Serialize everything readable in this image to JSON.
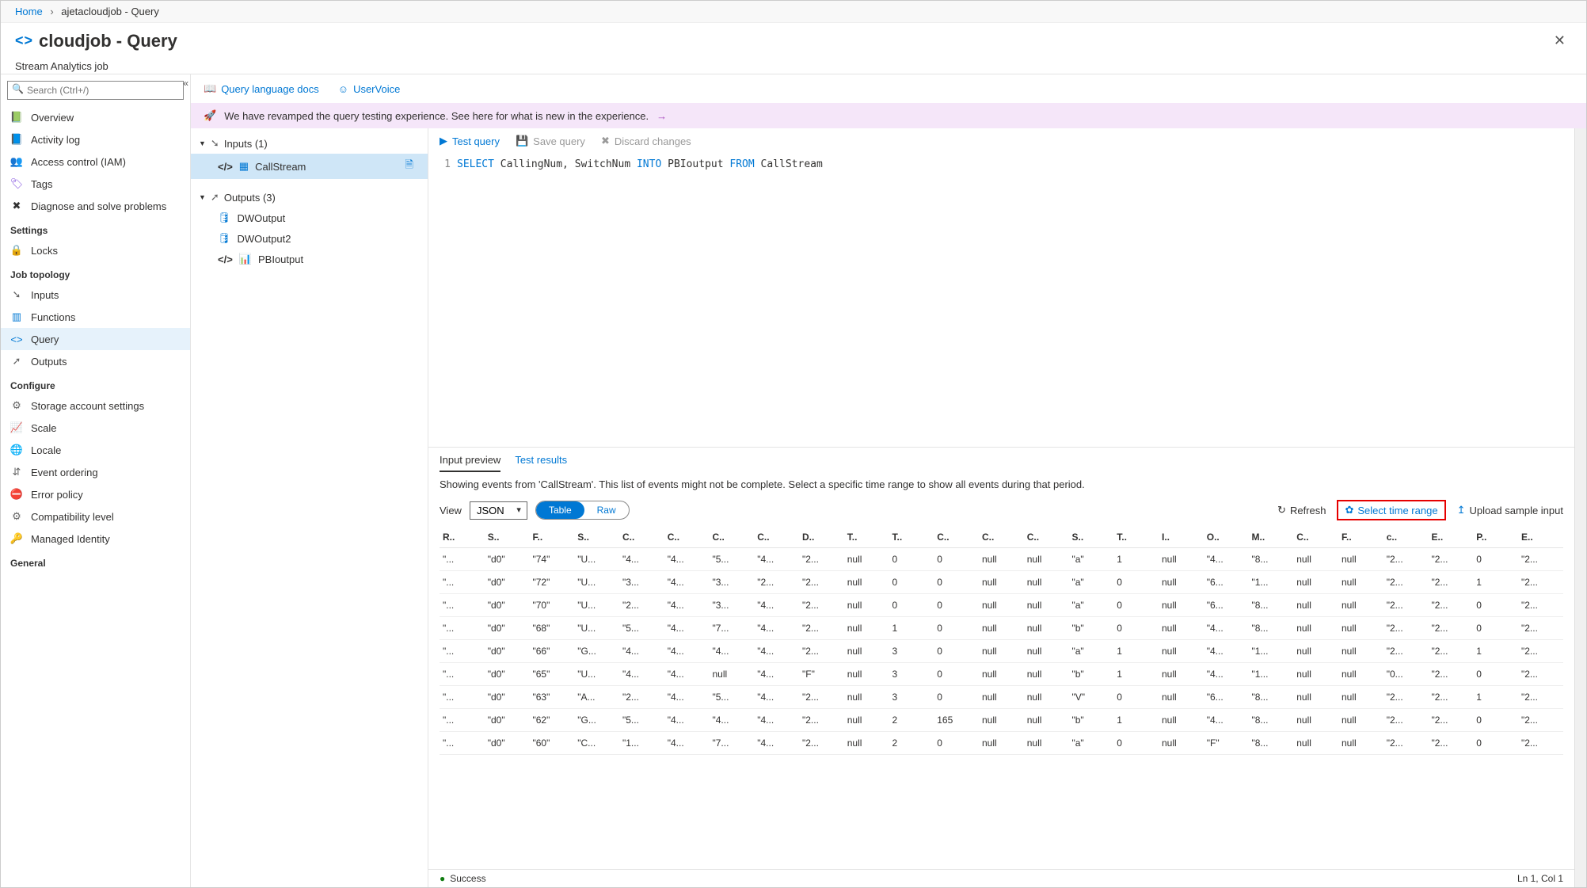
{
  "breadcrumb": {
    "home": "Home",
    "page": "ajetacloudjob - Query"
  },
  "header": {
    "title": "cloudjob - Query",
    "subtitle": "Stream Analytics job"
  },
  "search": {
    "placeholder": "Search (Ctrl+/)"
  },
  "nav": {
    "group1": [
      {
        "id": "overview",
        "label": "Overview",
        "icon": "📗",
        "color": "#2e8540"
      },
      {
        "id": "activity",
        "label": "Activity log",
        "icon": "📘",
        "color": "#0078d4"
      },
      {
        "id": "access",
        "label": "Access control (IAM)",
        "icon": "👥",
        "color": "#0078d4"
      },
      {
        "id": "tags",
        "label": "Tags",
        "icon": "🏷",
        "color": "#8250df"
      },
      {
        "id": "diagnose",
        "label": "Diagnose and solve problems",
        "icon": "✖",
        "color": "#333"
      }
    ],
    "settings_label": "Settings",
    "settings": [
      {
        "id": "locks",
        "label": "Locks",
        "icon": "🔒",
        "color": "#333"
      }
    ],
    "topology_label": "Job topology",
    "topology": [
      {
        "id": "inputs",
        "label": "Inputs",
        "icon": "➘",
        "color": "#666"
      },
      {
        "id": "functions",
        "label": "Functions",
        "icon": "▥",
        "color": "#0078d4"
      },
      {
        "id": "query",
        "label": "Query",
        "icon": "<>",
        "color": "#0078d4",
        "selected": true
      },
      {
        "id": "outputs",
        "label": "Outputs",
        "icon": "➚",
        "color": "#666"
      }
    ],
    "configure_label": "Configure",
    "configure": [
      {
        "id": "storage",
        "label": "Storage account settings",
        "icon": "⚙",
        "color": "#666"
      },
      {
        "id": "scale",
        "label": "Scale",
        "icon": "📈",
        "color": "#0078d4"
      },
      {
        "id": "locale",
        "label": "Locale",
        "icon": "🌐",
        "color": "#2e8540"
      },
      {
        "id": "ordering",
        "label": "Event ordering",
        "icon": "⇵",
        "color": "#666"
      },
      {
        "id": "error",
        "label": "Error policy",
        "icon": "⛔",
        "color": "#d13438"
      },
      {
        "id": "compat",
        "label": "Compatibility level",
        "icon": "⚙",
        "color": "#666"
      },
      {
        "id": "identity",
        "label": "Managed Identity",
        "icon": "🔑",
        "color": "#f2c811"
      }
    ],
    "general_label": "General"
  },
  "toolbar": {
    "docs": "Query language docs",
    "uservoice": "UserVoice"
  },
  "banner": "We have revamped the query testing experience. See here for what is new in the experience.",
  "tree": {
    "inputs_label": "Inputs (1)",
    "inputs": [
      {
        "id": "callstream",
        "label": "CallStream",
        "selected": true
      }
    ],
    "outputs_label": "Outputs (3)",
    "outputs": [
      {
        "id": "dwoutput",
        "label": "DWOutput",
        "icon": "db"
      },
      {
        "id": "dwoutput2",
        "label": "DWOutput2",
        "icon": "db"
      },
      {
        "id": "pbioutput",
        "label": "PBIoutput",
        "icon": "chart"
      }
    ]
  },
  "editor": {
    "test": "Test query",
    "save": "Save query",
    "discard": "Discard changes",
    "line_no": "1",
    "query_parts": {
      "select": "SELECT",
      "cols": " CallingNum, SwitchNum ",
      "into": "INTO",
      "tgt": " PBIoutput ",
      "from": "FROM",
      "src": " CallStream"
    }
  },
  "results": {
    "tab_preview": "Input preview",
    "tab_results": "Test results",
    "message": "Showing events from 'CallStream'. This list of events might not be complete. Select a specific time range to show all events during that period.",
    "view_label": "View",
    "view_select": "JSON",
    "toggle_table": "Table",
    "toggle_raw": "Raw",
    "refresh": "Refresh",
    "timerange": "Select time range",
    "upload": "Upload sample input",
    "headers": [
      "R..",
      "S..",
      "F..",
      "S..",
      "C..",
      "C..",
      "C..",
      "C..",
      "D..",
      "T..",
      "T..",
      "C..",
      "C..",
      "C..",
      "S..",
      "T..",
      "I..",
      "O..",
      "M..",
      "C..",
      "F..",
      "c..",
      "E..",
      "P..",
      "E.."
    ],
    "rows": [
      [
        "\"...",
        "\"d0\"",
        "\"74\"",
        "\"U...",
        "\"4...",
        "\"4...",
        "\"5...",
        "\"4...",
        "\"2...",
        "null",
        "0",
        "0",
        "null",
        "null",
        "\"a\"",
        "1",
        "null",
        "\"4...",
        "\"8...",
        "null",
        "null",
        "\"2...",
        "\"2...",
        "0",
        "\"2..."
      ],
      [
        "\"...",
        "\"d0\"",
        "\"72\"",
        "\"U...",
        "\"3...",
        "\"4...",
        "\"3...",
        "\"2...",
        "\"2...",
        "null",
        "0",
        "0",
        "null",
        "null",
        "\"a\"",
        "0",
        "null",
        "\"6...",
        "\"1...",
        "null",
        "null",
        "\"2...",
        "\"2...",
        "1",
        "\"2..."
      ],
      [
        "\"...",
        "\"d0\"",
        "\"70\"",
        "\"U...",
        "\"2...",
        "\"4...",
        "\"3...",
        "\"4...",
        "\"2...",
        "null",
        "0",
        "0",
        "null",
        "null",
        "\"a\"",
        "0",
        "null",
        "\"6...",
        "\"8...",
        "null",
        "null",
        "\"2...",
        "\"2...",
        "0",
        "\"2..."
      ],
      [
        "\"...",
        "\"d0\"",
        "\"68\"",
        "\"U...",
        "\"5...",
        "\"4...",
        "\"7...",
        "\"4...",
        "\"2...",
        "null",
        "1",
        "0",
        "null",
        "null",
        "\"b\"",
        "0",
        "null",
        "\"4...",
        "\"8...",
        "null",
        "null",
        "\"2...",
        "\"2...",
        "0",
        "\"2..."
      ],
      [
        "\"...",
        "\"d0\"",
        "\"66\"",
        "\"G...",
        "\"4...",
        "\"4...",
        "\"4...",
        "\"4...",
        "\"2...",
        "null",
        "3",
        "0",
        "null",
        "null",
        "\"a\"",
        "1",
        "null",
        "\"4...",
        "\"1...",
        "null",
        "null",
        "\"2...",
        "\"2...",
        "1",
        "\"2..."
      ],
      [
        "\"...",
        "\"d0\"",
        "\"65\"",
        "\"U...",
        "\"4...",
        "\"4...",
        "null",
        "\"4...",
        "\"F\"",
        "null",
        "3",
        "0",
        "null",
        "null",
        "\"b\"",
        "1",
        "null",
        "\"4...",
        "\"1...",
        "null",
        "null",
        "\"0...",
        "\"2...",
        "0",
        "\"2..."
      ],
      [
        "\"...",
        "\"d0\"",
        "\"63\"",
        "\"A...",
        "\"2...",
        "\"4...",
        "\"5...",
        "\"4...",
        "\"2...",
        "null",
        "3",
        "0",
        "null",
        "null",
        "\"V\"",
        "0",
        "null",
        "\"6...",
        "\"8...",
        "null",
        "null",
        "\"2...",
        "\"2...",
        "1",
        "\"2..."
      ],
      [
        "\"...",
        "\"d0\"",
        "\"62\"",
        "\"G...",
        "\"5...",
        "\"4...",
        "\"4...",
        "\"4...",
        "\"2...",
        "null",
        "2",
        "165",
        "null",
        "null",
        "\"b\"",
        "1",
        "null",
        "\"4...",
        "\"8...",
        "null",
        "null",
        "\"2...",
        "\"2...",
        "0",
        "\"2..."
      ],
      [
        "\"...",
        "\"d0\"",
        "\"60\"",
        "\"C...",
        "\"1...",
        "\"4...",
        "\"7...",
        "\"4...",
        "\"2...",
        "null",
        "2",
        "0",
        "null",
        "null",
        "\"a\"",
        "0",
        "null",
        "\"F\"",
        "\"8...",
        "null",
        "null",
        "\"2...",
        "\"2...",
        "0",
        "\"2..."
      ]
    ]
  },
  "status": {
    "ok": "Success",
    "pos": "Ln 1, Col 1"
  }
}
